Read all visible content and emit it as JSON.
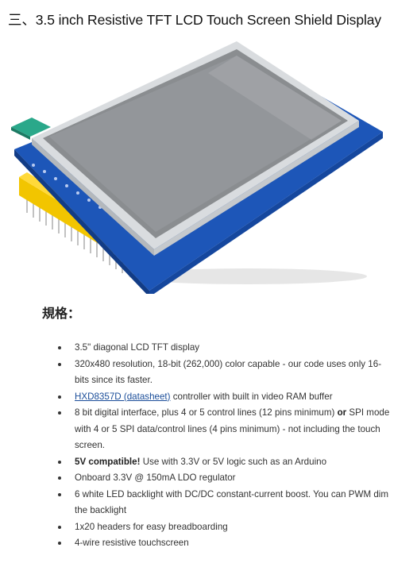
{
  "title": "三、3.5 inch Resistive TFT LCD Touch Screen Shield Display",
  "specs_heading": "規格：",
  "specs": {
    "item1": "3.5\" diagonal LCD TFT display",
    "item2": "320x480 resolution, 18-bit (262,000) color capable - our code uses only 16-bits since its faster.",
    "item3_link": "HXD8357D (datasheet)",
    "item3_rest": " controller with built in video RAM buffer",
    "item4_a": "8 bit digital interface, plus 4 or 5 control lines (12 pins minimum) ",
    "item4_or": "or",
    "item4_b": " SPI mode with 4 or 5 SPI data/control lines (4 pins minimum) - not including the touch screen.",
    "item5_bold": "5V compatible!",
    "item5_rest": "  Use with 3.3V or 5V logic such as an Arduino",
    "item6": "Onboard 3.3V @ 150mA LDO regulator",
    "item7": "6 white LED backlight with DC/DC constant-current boost. You can PWM dim the backlight",
    "item8": "1x20 headers for easy breadboarding",
    "item9": "4-wire resistive touchscreen"
  },
  "colors": {
    "link": "#1a4d99",
    "pcb": "#1d56b8",
    "pins": "#f2c500",
    "screen": "#8a8d90"
  }
}
